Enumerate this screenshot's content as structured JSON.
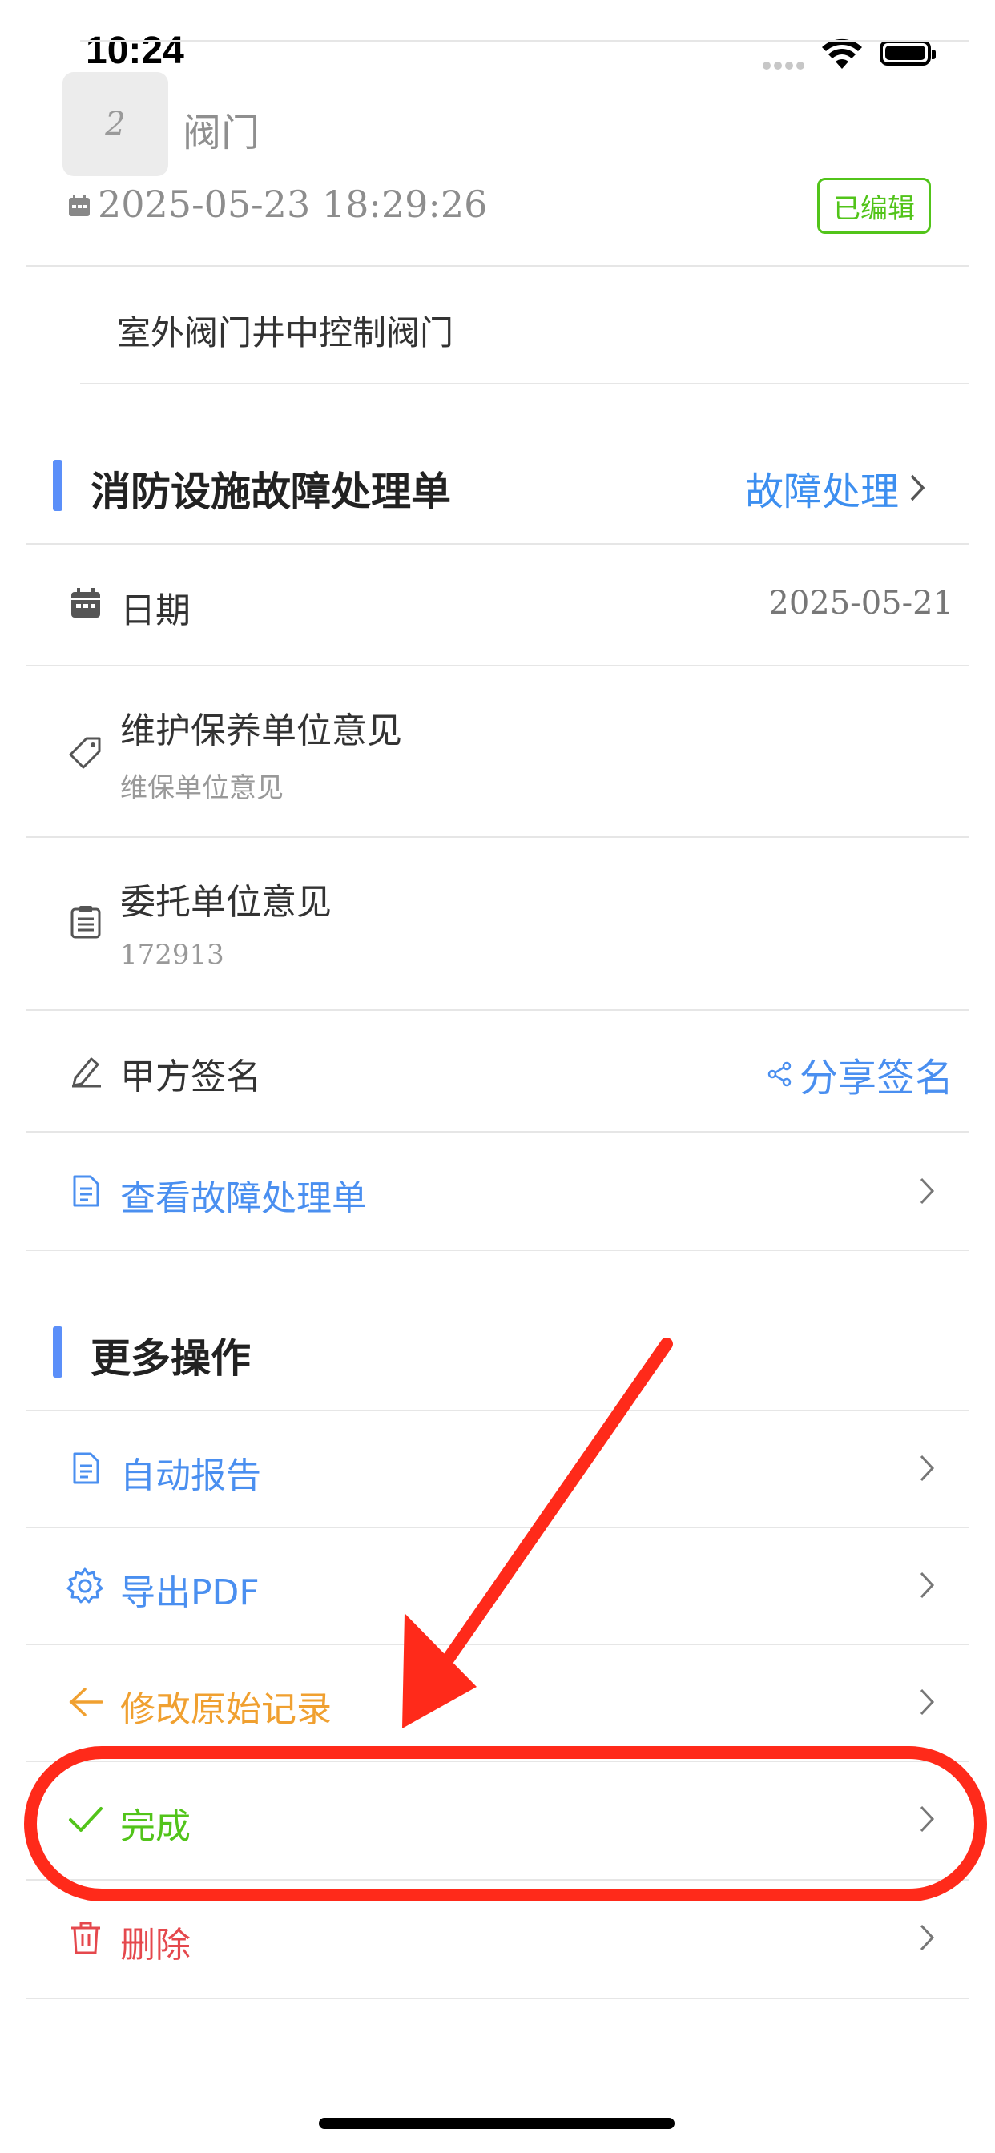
{
  "status_bar": {
    "time": "10:24"
  },
  "record": {
    "index": "2",
    "name": "阀门",
    "datetime": "2025-05-23 18:29:26",
    "badge": "已编辑",
    "description": "室外阀门井中控制阀门"
  },
  "fault_section": {
    "title": "消防设施故障处理单",
    "link": "故障处理",
    "rows": [
      {
        "label": "日期",
        "value": "2025-05-21",
        "icon": "calendar-icon"
      },
      {
        "label": "维护保养单位意见",
        "sub": "维保单位意见",
        "icon": "tag-icon"
      },
      {
        "label": "委托单位意见",
        "sub": "172913",
        "icon": "clipboard-icon"
      },
      {
        "label": "甲方签名",
        "action": "分享签名",
        "icon": "pen-icon",
        "action_icon": "share-icon"
      },
      {
        "label": "查看故障处理单",
        "icon": "document-icon"
      }
    ]
  },
  "more_section": {
    "title": "更多操作",
    "items": [
      {
        "label": "自动报告",
        "icon": "document-icon",
        "color": "#4a8ff0"
      },
      {
        "label": "导出PDF",
        "icon": "gear-icon",
        "color": "#4a8ff0"
      },
      {
        "label": "修改原始记录",
        "icon": "arrow-left-icon",
        "color": "#f0a030"
      },
      {
        "label": "完成",
        "icon": "check-icon",
        "color": "#52c41a"
      },
      {
        "label": "删除",
        "icon": "trash-icon",
        "color": "#e5484d"
      }
    ]
  },
  "annotation": {
    "color": "#ff2a1a",
    "highlighted_item": "完成"
  }
}
